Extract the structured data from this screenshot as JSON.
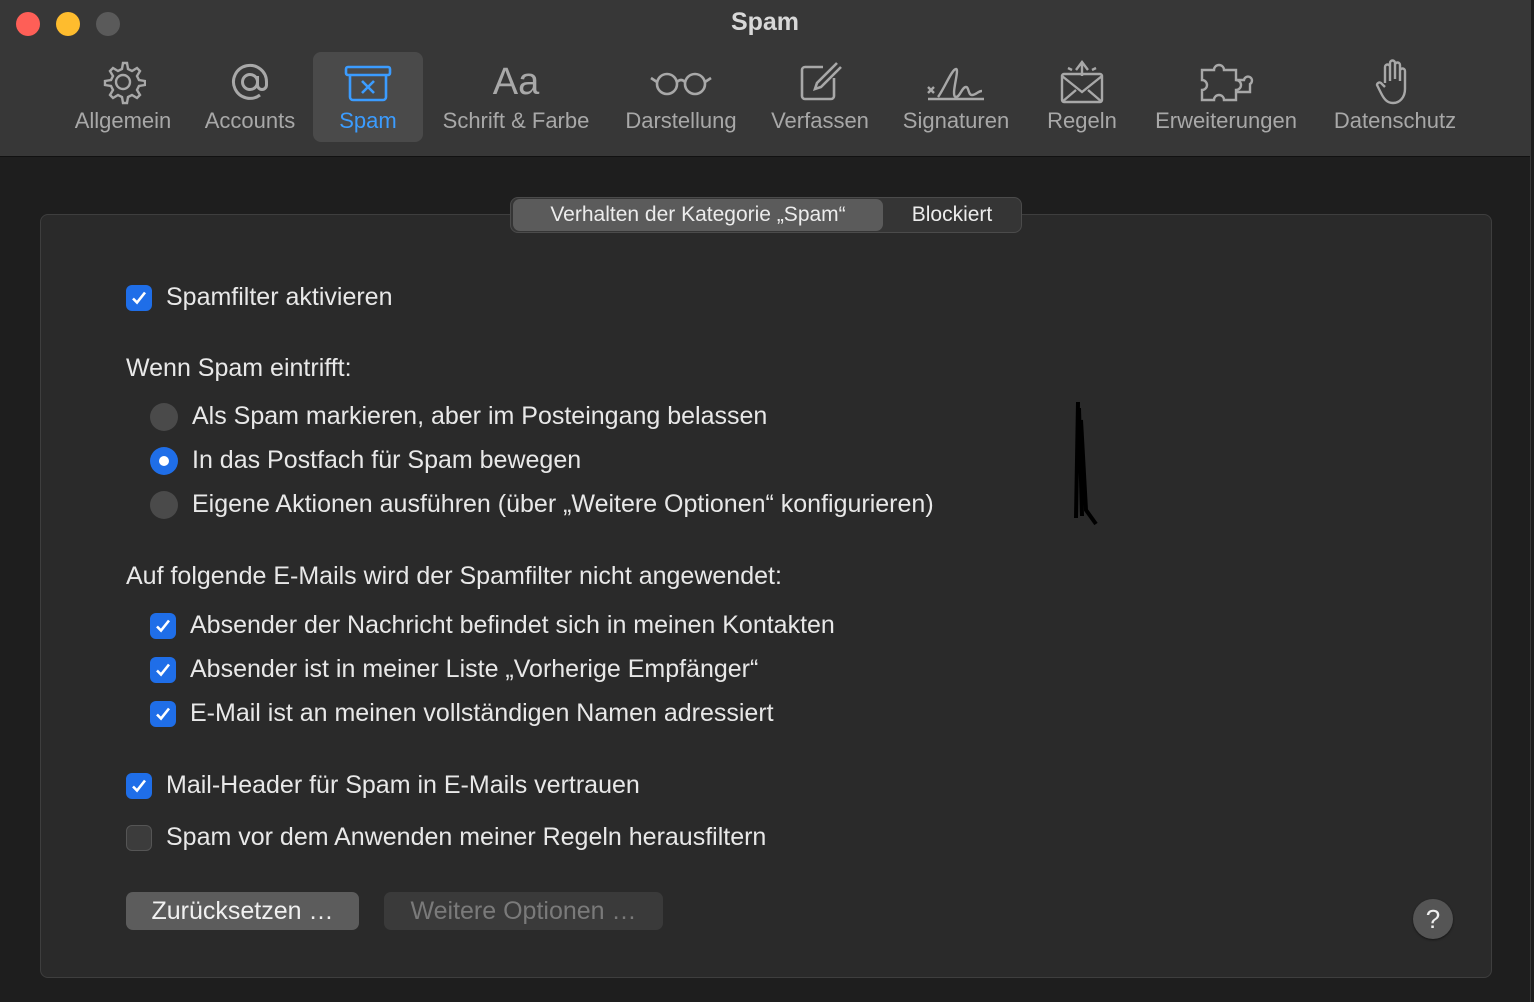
{
  "window": {
    "title": "Spam"
  },
  "toolbar": {
    "items": [
      {
        "label": "Allgemein",
        "icon": "gear-icon"
      },
      {
        "label": "Accounts",
        "icon": "at-icon"
      },
      {
        "label": "Spam",
        "icon": "spam-box-icon",
        "selected": true
      },
      {
        "label": "Schrift & Farbe",
        "icon": "font-icon"
      },
      {
        "label": "Darstellung",
        "icon": "glasses-icon"
      },
      {
        "label": "Verfassen",
        "icon": "compose-icon"
      },
      {
        "label": "Signaturen",
        "icon": "signature-icon"
      },
      {
        "label": "Regeln",
        "icon": "rules-envelope-icon"
      },
      {
        "label": "Erweiterungen",
        "icon": "puzzle-icon"
      },
      {
        "label": "Datenschutz",
        "icon": "hand-icon"
      }
    ],
    "font_glyph": "Aa"
  },
  "tabs": {
    "active": "Verhalten der Kategorie „Spam“",
    "inactive": "Blockiert"
  },
  "settings": {
    "enable_filter": {
      "label": "Spamfilter aktivieren",
      "checked": true
    },
    "when_spam_heading": "Wenn Spam eintrifft:",
    "radio": [
      {
        "label": "Als Spam markieren, aber im Posteingang belassen",
        "selected": false
      },
      {
        "label": "In das Postfach für Spam bewegen",
        "selected": true
      },
      {
        "label": "Eigene Aktionen ausführen (über „Weitere Optionen“ konfigurieren)",
        "selected": false
      }
    ],
    "exempt_heading": "Auf folgende E-Mails wird der Spamfilter nicht angewendet:",
    "exempt": [
      {
        "label": "Absender der Nachricht befindet sich in meinen Kontakten",
        "checked": true
      },
      {
        "label": "Absender ist in meiner Liste „Vorherige Empfänger“",
        "checked": true
      },
      {
        "label": "E-Mail ist an meinen vollständigen Namen adressiert",
        "checked": true
      }
    ],
    "trust_headers": {
      "label": "Mail-Header für Spam in E-Mails vertrauen",
      "checked": true
    },
    "filter_before_rules": {
      "label": "Spam vor dem Anwenden meiner Regeln herausfiltern",
      "checked": false
    }
  },
  "buttons": {
    "reset": "Zurücksetzen …",
    "more_options": "Weitere Optionen …",
    "help": "?"
  },
  "colors": {
    "accent": "#1f6ee8",
    "selected_tab_text": "#3b9cff",
    "close": "#fe5f57",
    "minimize": "#febc2e"
  }
}
